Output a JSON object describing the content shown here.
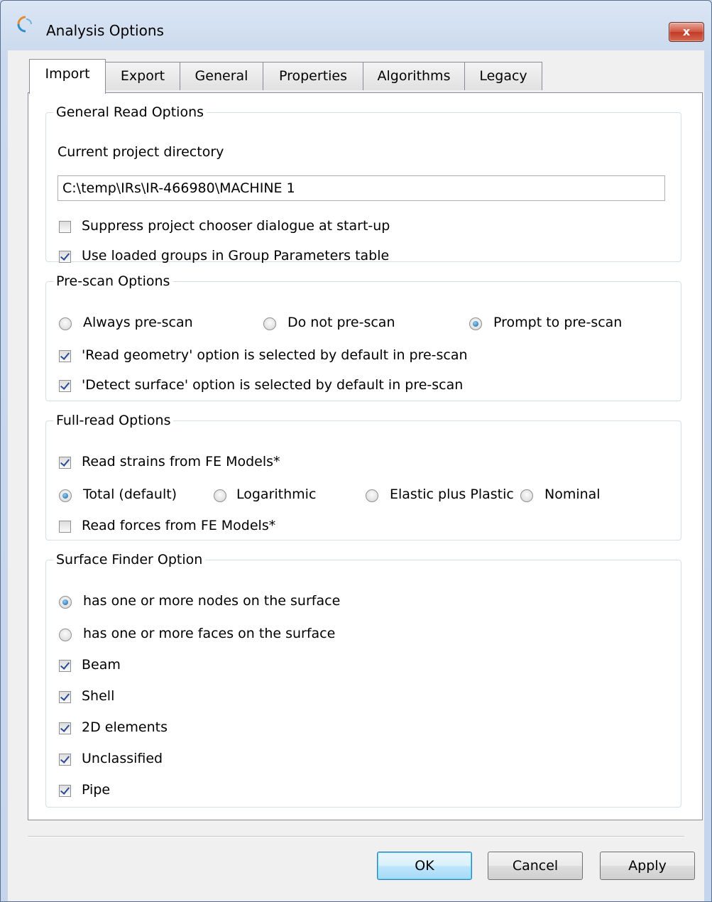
{
  "window": {
    "title": "Analysis Options",
    "close_label": "x"
  },
  "tabs": [
    {
      "label": "Import"
    },
    {
      "label": "Export"
    },
    {
      "label": "General"
    },
    {
      "label": "Properties"
    },
    {
      "label": "Algorithms"
    },
    {
      "label": "Legacy"
    }
  ],
  "general_read": {
    "legend": "General Read Options",
    "dir_label": "Current project directory",
    "dir_value": "C:\\temp\\IRs\\IR-466980\\MACHINE 1",
    "suppress_label": "Suppress project chooser dialogue at start-up",
    "suppress_checked": false,
    "loaded_groups_label": "Use loaded groups in Group Parameters table",
    "loaded_groups_checked": true
  },
  "prescan": {
    "legend": "Pre-scan Options",
    "always_label": "Always pre-scan",
    "donot_label": "Do not pre-scan",
    "prompt_label": "Prompt to pre-scan",
    "selected": "prompt",
    "read_geometry_label": "'Read geometry' option is selected by default in pre-scan",
    "read_geometry_checked": true,
    "detect_surface_label": "'Detect surface' option is selected by default in pre-scan",
    "detect_surface_checked": true
  },
  "fullread": {
    "legend": "Full-read Options",
    "strains_label": "Read strains from FE Models*",
    "strains_checked": true,
    "total_label": "Total (default)",
    "log_label": "Logarithmic",
    "elastic_label": "Elastic plus Plastic",
    "nominal_label": "Nominal",
    "selected": "total",
    "forces_label": "Read forces from FE Models*",
    "forces_checked": false
  },
  "surface": {
    "legend": "Surface Finder Option",
    "nodes_label": "has one or more nodes on the surface",
    "faces_label": "has one or more faces on the surface",
    "selected": "nodes",
    "beam_label": "Beam",
    "shell_label": "Shell",
    "elem2d_label": "2D elements",
    "unclassified_label": "Unclassified",
    "pipe_label": "Pipe"
  },
  "buttons": {
    "ok": "OK",
    "cancel": "Cancel",
    "apply": "Apply"
  }
}
